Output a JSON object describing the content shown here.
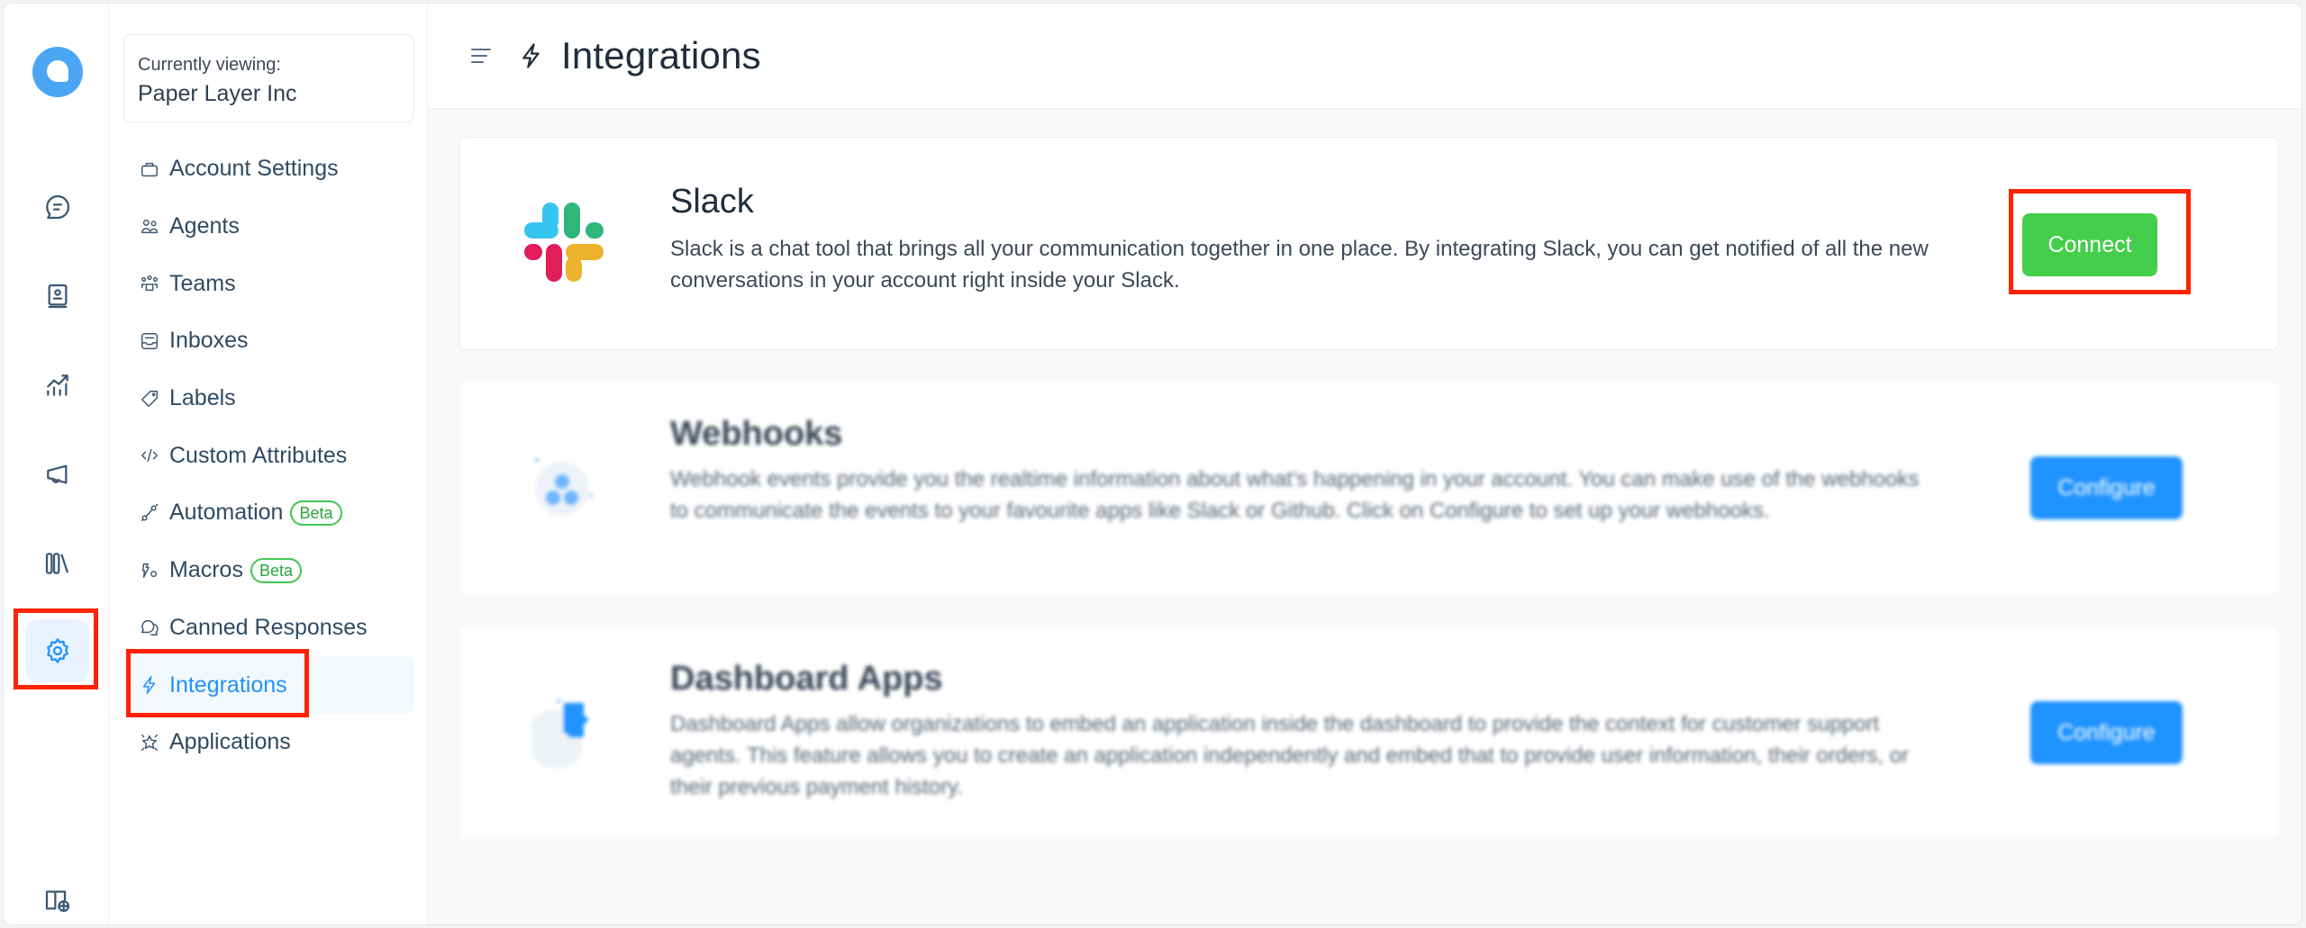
{
  "rail": {
    "items": [
      {
        "name": "conversations",
        "icon": "chat-bubble-icon",
        "active": false
      },
      {
        "name": "contacts",
        "icon": "contact-book-icon",
        "active": false
      },
      {
        "name": "reports",
        "icon": "chart-trend-icon",
        "active": false
      },
      {
        "name": "campaigns",
        "icon": "megaphone-icon",
        "active": false
      },
      {
        "name": "library",
        "icon": "library-icon",
        "active": false
      },
      {
        "name": "settings",
        "icon": "gear-icon",
        "active": true
      }
    ],
    "bottom_icon": "help-center-book-globe-icon"
  },
  "account": {
    "label": "Currently viewing:",
    "name": "Paper Layer Inc"
  },
  "sidebar": {
    "items": [
      {
        "label": "Account Settings",
        "icon": "briefcase-icon"
      },
      {
        "label": "Agents",
        "icon": "people-icon"
      },
      {
        "label": "Teams",
        "icon": "team-icon"
      },
      {
        "label": "Inboxes",
        "icon": "inbox-icon"
      },
      {
        "label": "Labels",
        "icon": "tag-icon"
      },
      {
        "label": "Custom Attributes",
        "icon": "code-icon"
      },
      {
        "label": "Automation",
        "icon": "automation-icon",
        "badge": "Beta"
      },
      {
        "label": "Macros",
        "icon": "macro-icon",
        "badge": "Beta"
      },
      {
        "label": "Canned Responses",
        "icon": "chat-multiple-icon"
      },
      {
        "label": "Integrations",
        "icon": "flash-icon",
        "active": true
      },
      {
        "label": "Applications",
        "icon": "star-emphasis-icon"
      }
    ]
  },
  "header": {
    "title": "Integrations",
    "icon": "flash-icon"
  },
  "integrations": [
    {
      "name": "Slack",
      "description": "Slack is a chat tool that brings all your communication together in one place. By integrating Slack, you can get notified of all the new conversations in your account right inside your Slack.",
      "button": "Connect",
      "button_color": "#44ce4b"
    },
    {
      "name": "Webhooks",
      "description": "Webhook events provide you the realtime information about what's happening in your account. You can make use of the webhooks to communicate the events to your favourite apps like Slack or Github. Click on Configure to set up your webhooks.",
      "button": "Configure",
      "button_color": "#1f93ff"
    },
    {
      "name": "Dashboard Apps",
      "description": "Dashboard Apps allow organizations to embed an application inside the dashboard to provide the context for customer support agents. This feature allows you to create an application independently and embed that to provide user information, their orders, or their previous payment history.",
      "button": "Configure",
      "button_color": "#1f93ff"
    }
  ],
  "colors": {
    "accent": "#1f93ff",
    "success": "#44ce4b",
    "annotation": "#ff2200"
  }
}
